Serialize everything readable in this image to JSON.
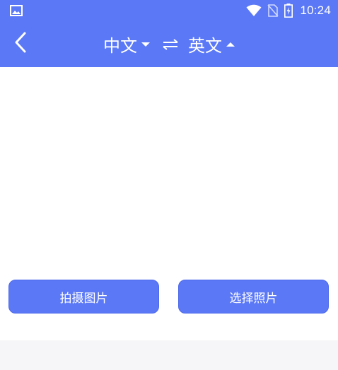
{
  "status_bar": {
    "time": "10:24",
    "icons": [
      "image-icon",
      "wifi-icon",
      "no-sim-icon",
      "battery-charging-icon"
    ]
  },
  "header": {
    "source_language": "中文",
    "target_language": "英文",
    "back_icon": "back-arrow-icon",
    "swap_icon": "swap-arrows-icon"
  },
  "actions": {
    "take_photo_label": "拍摄图片",
    "choose_photo_label": "选择照片"
  },
  "colors": {
    "primary": "#5b78f6",
    "background": "#ffffff",
    "bottom": "#f6f6f8"
  }
}
